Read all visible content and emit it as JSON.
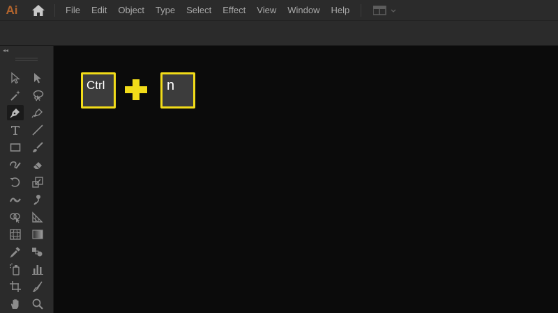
{
  "app": {
    "logo_text": "Ai",
    "logo_color": "#b1642d"
  },
  "menu": {
    "items": [
      "File",
      "Edit",
      "Object",
      "Type",
      "Select",
      "Effect",
      "View",
      "Window",
      "Help"
    ]
  },
  "shortcut": {
    "key1": "Ctrl",
    "key2": "n",
    "highlight_color": "#f2dc19"
  },
  "toolbar": {
    "collapse_glyph": "◂◂",
    "tools": [
      [
        "selection-tool-icon",
        "direct-selection-tool-icon"
      ],
      [
        "magic-wand-tool-icon",
        "lasso-tool-icon"
      ],
      [
        "pen-tool-icon",
        "curvature-tool-icon"
      ],
      [
        "type-tool-icon",
        "line-segment-tool-icon"
      ],
      [
        "rectangle-tool-icon",
        "paintbrush-tool-icon"
      ],
      [
        "shaper-tool-icon",
        "eraser-tool-icon"
      ],
      [
        "rotate-tool-icon",
        "scale-tool-icon"
      ],
      [
        "width-tool-icon",
        "puppet-warp-tool-icon"
      ],
      [
        "shape-builder-tool-icon",
        "perspective-grid-tool-icon"
      ],
      [
        "mesh-tool-icon",
        "gradient-tool-icon"
      ],
      [
        "eyedropper-tool-icon",
        "blend-tool-icon"
      ],
      [
        "symbol-sprayer-tool-icon",
        "column-graph-tool-icon"
      ],
      [
        "artboard-tool-icon",
        "slice-tool-icon"
      ],
      [
        "hand-tool-icon",
        "zoom-tool-icon"
      ]
    ]
  }
}
